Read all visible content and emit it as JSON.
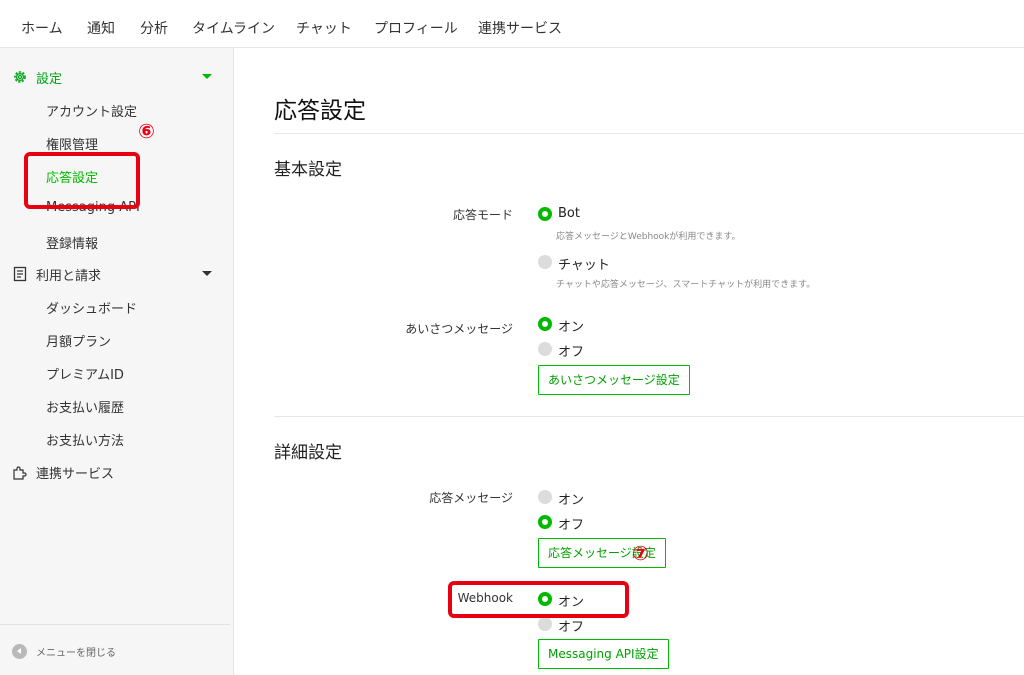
{
  "topnav": {
    "tabs": [
      "ホーム",
      "通知",
      "分析",
      "タイムライン",
      "チャット",
      "プロフィール",
      "連携サービス"
    ]
  },
  "sidebar": {
    "settings_group": "設定",
    "settings_items": [
      "アカウント設定",
      "権限管理",
      "応答設定",
      "Messaging API",
      "登録情報"
    ],
    "billing_group": "利用と請求",
    "billing_items": [
      "ダッシュボード",
      "月額プラン",
      "プレミアムID",
      "お支払い履歴",
      "お支払い方法"
    ],
    "integration_group": "連携サービス",
    "close_menu": "メニューを閉じる"
  },
  "main": {
    "page_title": "応答設定",
    "basic": {
      "title": "基本設定",
      "response_mode": {
        "label": "応答モード",
        "bot": "Bot",
        "bot_hint": "応答メッセージとWebhookが利用できます。",
        "chat": "チャット",
        "chat_hint": "チャットや応答メッセージ、スマートチャットが利用できます。",
        "selected": "Bot"
      },
      "greeting": {
        "label": "あいさつメッセージ",
        "on": "オン",
        "off": "オフ",
        "selected": "オン",
        "button": "あいさつメッセージ設定"
      }
    },
    "detail": {
      "title": "詳細設定",
      "auto_reply": {
        "label": "応答メッセージ",
        "on": "オン",
        "off": "オフ",
        "selected": "オフ",
        "button": "応答メッセージ設定"
      },
      "webhook": {
        "label": "Webhook",
        "on": "オン",
        "off": "オフ",
        "selected": "オン",
        "button": "Messaging API設定"
      }
    }
  },
  "annotations": {
    "step6": "⑥",
    "step7": "⑦",
    "color": "#e60012"
  },
  "colors": {
    "accent": "#00b900"
  }
}
